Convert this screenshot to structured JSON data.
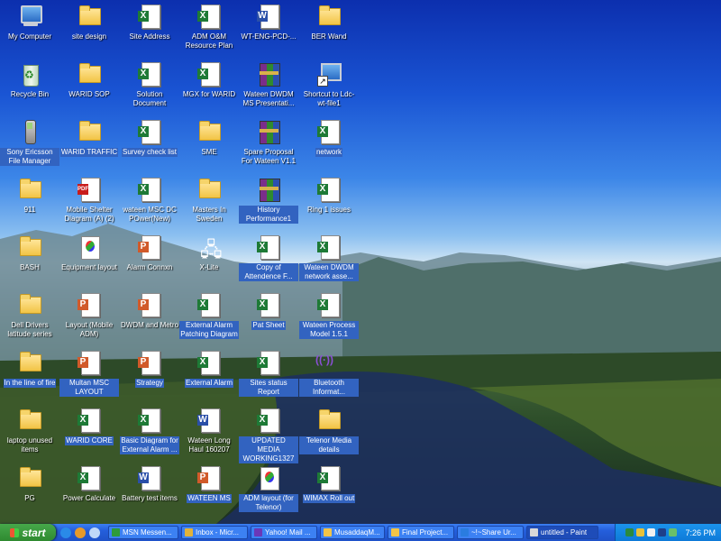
{
  "desktop": {
    "icons": [
      {
        "label": "My Computer",
        "type": "computer",
        "col": 0,
        "row": 0
      },
      {
        "label": "Recycle Bin",
        "type": "bin",
        "col": 0,
        "row": 1
      },
      {
        "label": "Sony Ericsson File Manager",
        "type": "phone",
        "col": 0,
        "row": 2,
        "selected": true
      },
      {
        "label": "911",
        "type": "folder",
        "col": 0,
        "row": 3
      },
      {
        "label": "BASH",
        "type": "folder",
        "col": 0,
        "row": 4
      },
      {
        "label": "Dell Drivers latitude series",
        "type": "folder",
        "col": 0,
        "row": 5
      },
      {
        "label": "In the line of fire",
        "type": "folder",
        "col": 0,
        "row": 6,
        "selected": true
      },
      {
        "label": "laptop unused items",
        "type": "folder",
        "col": 0,
        "row": 7
      },
      {
        "label": "PG",
        "type": "folder",
        "col": 0,
        "row": 8
      },
      {
        "label": "site design",
        "type": "folder",
        "col": 1,
        "row": 0
      },
      {
        "label": "WARID SOP",
        "type": "folder",
        "col": 1,
        "row": 1
      },
      {
        "label": "WARID TRAFFIC",
        "type": "folder",
        "col": 1,
        "row": 2,
        "selected": true
      },
      {
        "label": "Mobile Shelter Diagram (A) (2)",
        "type": "pdf",
        "col": 1,
        "row": 3
      },
      {
        "label": "Equipment layout",
        "type": "paint",
        "col": 1,
        "row": 4
      },
      {
        "label": "Layout (Mobile ADM)",
        "type": "ppt",
        "col": 1,
        "row": 5
      },
      {
        "label": "Multan MSC LAYOUT",
        "type": "ppt",
        "col": 1,
        "row": 6,
        "selected": true
      },
      {
        "label": "WARID CORE",
        "type": "xl",
        "col": 1,
        "row": 7,
        "selected": true
      },
      {
        "label": "Power Calculate",
        "type": "xl",
        "col": 1,
        "row": 8
      },
      {
        "label": "Site Address",
        "type": "xl",
        "col": 2,
        "row": 0
      },
      {
        "label": "Solution Document",
        "type": "xl",
        "col": 2,
        "row": 1
      },
      {
        "label": "Survey check list",
        "type": "xl",
        "col": 2,
        "row": 2,
        "selected": true
      },
      {
        "label": "wateen MSC DC POwer(New)",
        "type": "xl",
        "col": 2,
        "row": 3
      },
      {
        "label": "Alarm Connxn",
        "type": "ppt",
        "col": 2,
        "row": 4
      },
      {
        "label": "DWDM and Metro",
        "type": "ppt",
        "col": 2,
        "row": 5
      },
      {
        "label": "Strategy",
        "type": "ppt",
        "col": 2,
        "row": 6,
        "selected": true
      },
      {
        "label": "Basic Diagram for External Alarm ...",
        "type": "xl",
        "col": 2,
        "row": 7,
        "selected": true
      },
      {
        "label": "Battery test items",
        "type": "wd",
        "col": 2,
        "row": 8
      },
      {
        "label": "ADM O&M Resource Plan",
        "type": "xl",
        "col": 3,
        "row": 0
      },
      {
        "label": "MGX for WARID",
        "type": "xl",
        "col": 3,
        "row": 1
      },
      {
        "label": "SME",
        "type": "folder",
        "col": 3,
        "row": 2
      },
      {
        "label": "Masters In Sweden",
        "type": "folder",
        "col": 3,
        "row": 3
      },
      {
        "label": "X-Lite",
        "type": "xlite",
        "col": 3,
        "row": 4
      },
      {
        "label": "External Alarm Patching Diagram",
        "type": "xl",
        "col": 3,
        "row": 5,
        "selected": true
      },
      {
        "label": "External Alarm",
        "type": "xl",
        "col": 3,
        "row": 6,
        "selected": true
      },
      {
        "label": "Wateen Long Haul 160207",
        "type": "wd",
        "col": 3,
        "row": 7
      },
      {
        "label": "WATEEN MS",
        "type": "ppt",
        "col": 3,
        "row": 8,
        "selected": true
      },
      {
        "label": "WT-ENG-PCD-...",
        "type": "wd",
        "col": 4,
        "row": 0
      },
      {
        "label": "Wateen DWDM MS Presentati...",
        "type": "rar",
        "col": 4,
        "row": 1
      },
      {
        "label": "Spare Proposal For Wateen V1.1",
        "type": "rar",
        "col": 4,
        "row": 2
      },
      {
        "label": "History Performance1",
        "type": "rar",
        "col": 4,
        "row": 3,
        "selected": true
      },
      {
        "label": "Copy of Attendence F...",
        "type": "xl",
        "col": 4,
        "row": 4,
        "selected": true
      },
      {
        "label": "Pat Sheet",
        "type": "xl",
        "col": 4,
        "row": 5,
        "selected": true
      },
      {
        "label": "Sites status Report",
        "type": "xl",
        "col": 4,
        "row": 6,
        "selected": true
      },
      {
        "label": "UPDATED MEDIA WORKING1327",
        "type": "xl",
        "col": 4,
        "row": 7,
        "selected": true
      },
      {
        "label": "ADM layout (for Telenor)",
        "type": "paint",
        "col": 4,
        "row": 8,
        "selected": true
      },
      {
        "label": "BER Wand",
        "type": "folder",
        "col": 5,
        "row": 0
      },
      {
        "label": "Shortcut to Ldc-wt-file1",
        "type": "shortcut",
        "col": 5,
        "row": 1
      },
      {
        "label": "network",
        "type": "xl",
        "col": 5,
        "row": 2,
        "selected": true
      },
      {
        "label": "Ring 1 issues",
        "type": "xl",
        "col": 5,
        "row": 3
      },
      {
        "label": "Wateen DWDM network asse...",
        "type": "xl",
        "col": 5,
        "row": 4,
        "selected": true
      },
      {
        "label": "Wateen Process Model 1.5.1",
        "type": "xl",
        "col": 5,
        "row": 5,
        "selected": true
      },
      {
        "label": "Bluetooth Informat...",
        "type": "bt",
        "col": 5,
        "row": 6,
        "selected": true
      },
      {
        "label": "Telenor Media details",
        "type": "folder",
        "col": 5,
        "row": 7,
        "selected": true
      },
      {
        "label": "WIMAX Roll out",
        "type": "xl",
        "col": 5,
        "row": 8,
        "selected": true
      }
    ]
  },
  "taskbar": {
    "start_label": "start",
    "tasks": [
      {
        "label": "MSN Messen...",
        "color": "#2e9b3a"
      },
      {
        "label": "Inbox - Micr...",
        "color": "#e2b23a"
      },
      {
        "label": "Yahoo! Mail ...",
        "color": "#6a38b8"
      },
      {
        "label": "MusaddaqM...",
        "color": "#f2c446"
      },
      {
        "label": "Final Project...",
        "color": "#f2c446"
      },
      {
        "label": "~!~Share Ur...",
        "color": "#2a7ce0"
      },
      {
        "label": "untitled - Paint",
        "color": "#d8d8d8",
        "active": true
      }
    ],
    "clock": "7:26 PM"
  }
}
